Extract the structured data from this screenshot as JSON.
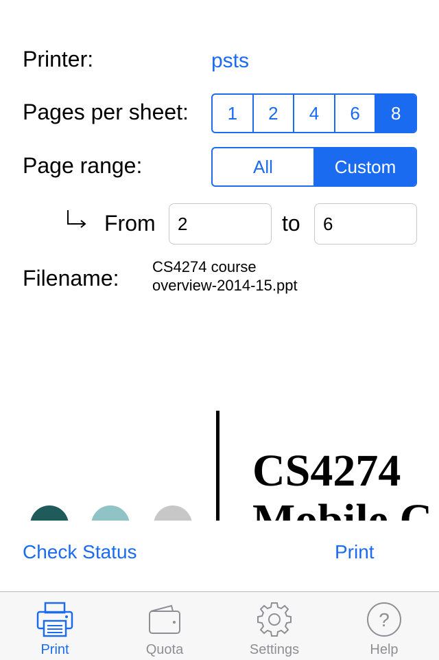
{
  "form": {
    "printer_label": "Printer:",
    "printer_value": "psts",
    "pages_per_sheet_label": "Pages per sheet:",
    "pages_per_sheet_options": [
      "1",
      "2",
      "4",
      "6",
      "8"
    ],
    "pages_per_sheet_selected": "8",
    "page_range_label": "Page range:",
    "page_range_options": [
      "All",
      "Custom"
    ],
    "page_range_selected": "Custom",
    "from_label": "From",
    "from_value": "2",
    "to_label": "to",
    "to_value": "6",
    "filename_label": "Filename:",
    "filename_line1": "CS4274 course",
    "filename_line2": "overview-2014-15.ppt"
  },
  "preview": {
    "title_line1": "CS4274",
    "title_line2": "Mobile C",
    "dot_colors": [
      "#1f5b5a",
      "#8fc3c5",
      "#c7c7c7"
    ]
  },
  "actions": {
    "check_status": "Check Status",
    "print": "Print"
  },
  "tabbar": {
    "tabs": [
      {
        "label": "Print",
        "icon": "printer-icon"
      },
      {
        "label": "Quota",
        "icon": "wallet-icon"
      },
      {
        "label": "Settings",
        "icon": "gear-icon"
      },
      {
        "label": "Help",
        "icon": "help-icon"
      }
    ],
    "active": "Print"
  },
  "colors": {
    "accent": "#1a6bf0",
    "tab_inactive": "#8e8e93"
  }
}
